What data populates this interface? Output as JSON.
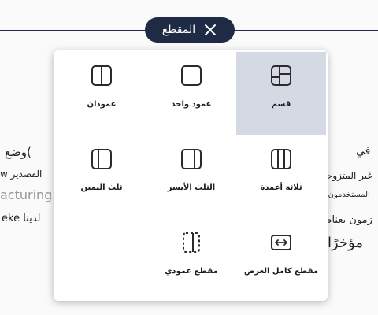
{
  "section_pill": {
    "label": "المقطع",
    "close_icon": "close-icon"
  },
  "layout_options": [
    {
      "label": "قسم",
      "icon": "layout-section-icon",
      "selected": true
    },
    {
      "label": "عمود واحد",
      "icon": "one-column-icon",
      "selected": false
    },
    {
      "label": "عمودان",
      "icon": "two-columns-icon",
      "selected": false
    },
    {
      "label": "ثلاثة أعمدة",
      "icon": "three-columns-icon",
      "selected": false
    },
    {
      "label": "الثلث الأيسر",
      "icon": "left-third-icon",
      "selected": false
    },
    {
      "label": "ثلث اليمين",
      "icon": "right-third-icon",
      "selected": false
    },
    {
      "label": "مقطع كامل العرض",
      "icon": "full-width-section-icon",
      "selected": false
    },
    {
      "label": "مقطع عمودي",
      "icon": "vertical-section-icon",
      "selected": false
    }
  ],
  "background_text": {
    "frag_1": "في",
    "frag_2": ")وضع",
    "frag_3": "غير المتزوجات",
    "frag_4": "القصدير w",
    "frag_5": "المستخدمون الذين",
    "frag_6": "acturing",
    "frag_7": "لدينا eke",
    "frag_8": "زمون بعناصر t",
    "frag_9": "مؤخرًا"
  },
  "colors": {
    "pill_background": "#1f2a44",
    "selected_tile": "#d5d9e3",
    "icon_stroke": "#2b2b2b"
  }
}
